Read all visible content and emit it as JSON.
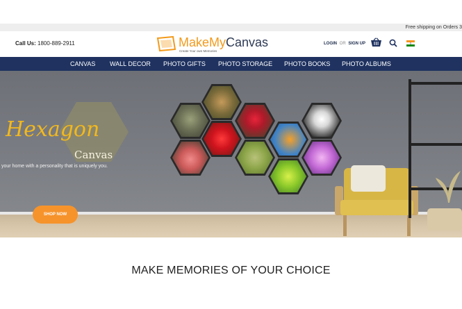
{
  "promo": {
    "text": "Free shipping on Orders 3"
  },
  "header": {
    "call_label": "Call Us:",
    "call_number": "1800-889-2911",
    "logo_make": "MakeMy",
    "logo_canvas": "Canvas",
    "logo_tagline": "Create Your own Memories",
    "login_label": "LOGIN",
    "or_label": "OR",
    "signup_label": "SIGN UP",
    "icons": [
      "cart-icon",
      "search-icon",
      "india-flag-icon"
    ]
  },
  "nav": {
    "items": [
      "CANVAS",
      "WALL DECOR",
      "PHOTO GIFTS",
      "PHOTO STORAGE",
      "PHOTO BOOKS",
      "PHOTO ALBUMS"
    ]
  },
  "hero": {
    "title": "Hexagon",
    "subtitle": "Canvas",
    "tagline": "your home with a personality that is uniquely you.",
    "cta": "SHOP NOW"
  },
  "section": {
    "title": "MAKE MEMORIES OF YOUR CHOICE"
  },
  "colors": {
    "nav_bg": "#1f3260",
    "brand_orange": "#f39a1b",
    "cta_orange": "#f6932b",
    "title_gold": "#f2b81e"
  }
}
